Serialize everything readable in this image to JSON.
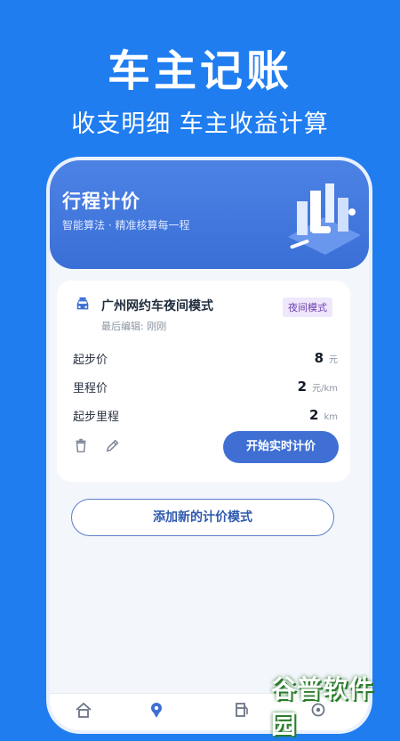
{
  "promo": {
    "title": "车主记账",
    "subtitle": "收支明细  车主收益计算"
  },
  "header": {
    "title": "行程计价",
    "subtitle": "智能算法 · 精准核算每一程"
  },
  "card": {
    "title": "广州网约车夜间模式",
    "badge": "夜间模式",
    "last_edit": "最后编辑: 刚刚",
    "rows": [
      {
        "label": "起步价",
        "value": "8",
        "unit": "元"
      },
      {
        "label": "里程价",
        "value": "2",
        "unit": "元/km"
      },
      {
        "label": "起步里程",
        "value": "2",
        "unit": "km"
      }
    ],
    "start_label": "开始实时计价"
  },
  "add_label": "添加新的计价模式",
  "watermark": "谷普软件园",
  "colors": {
    "background": "#1f7df0",
    "accent": "#3f6fd3",
    "badge": "#6b3fb0"
  },
  "icons": [
    "car-icon",
    "trash-icon",
    "edit-icon",
    "home-icon",
    "location-icon",
    "fuel-icon",
    "settings-icon"
  ]
}
